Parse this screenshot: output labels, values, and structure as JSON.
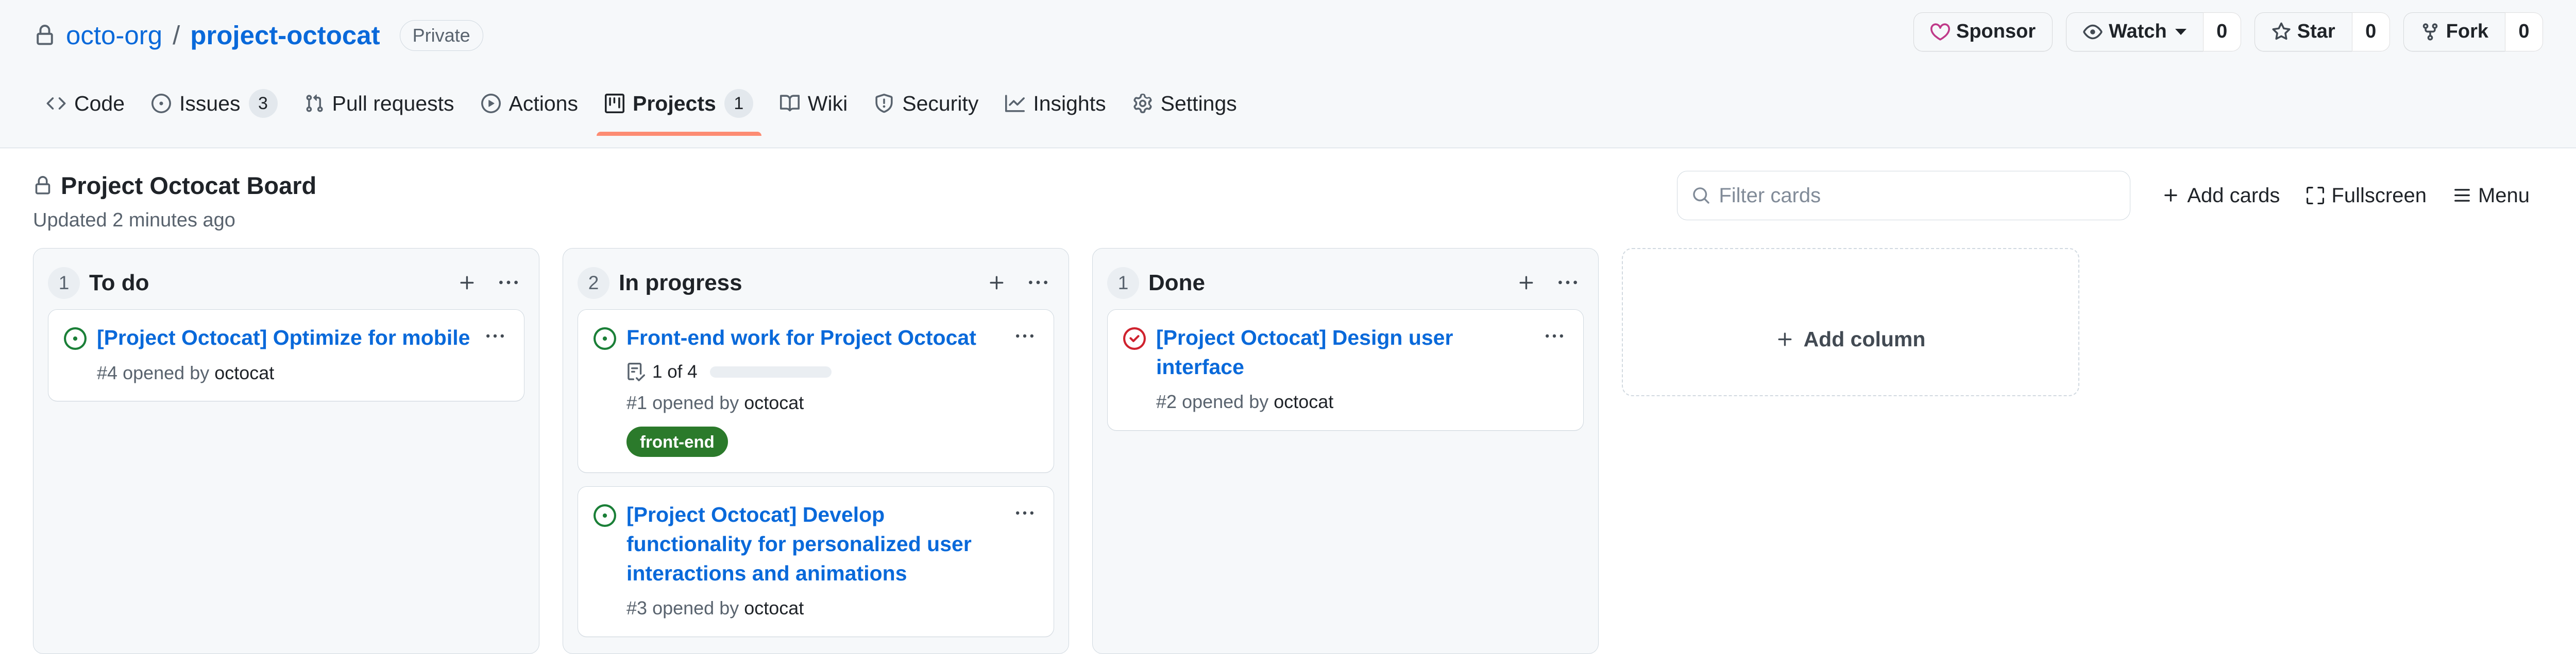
{
  "repo": {
    "visibility_icon": "lock-icon",
    "owner": "octo-org",
    "separator": "/",
    "name": "project-octocat",
    "visibility_badge": "Private"
  },
  "repo_actions": {
    "sponsor": {
      "label": "Sponsor",
      "icon": "heart-icon",
      "color": "#bf3989"
    },
    "watch": {
      "label": "Watch",
      "icon": "eye-icon",
      "count": "0"
    },
    "star": {
      "label": "Star",
      "icon": "star-icon",
      "count": "0"
    },
    "fork": {
      "label": "Fork",
      "icon": "fork-icon",
      "count": "0"
    }
  },
  "nav": {
    "active_color": "#fd8c73",
    "items": [
      {
        "label": "Code",
        "icon": "code-icon",
        "counter": null,
        "active": false
      },
      {
        "label": "Issues",
        "icon": "issue-opened-icon",
        "counter": "3",
        "active": false
      },
      {
        "label": "Pull requests",
        "icon": "git-pull-request-icon",
        "counter": null,
        "active": false
      },
      {
        "label": "Actions",
        "icon": "play-icon",
        "counter": null,
        "active": false
      },
      {
        "label": "Projects",
        "icon": "project-icon",
        "counter": "1",
        "active": true
      },
      {
        "label": "Wiki",
        "icon": "book-icon",
        "counter": null,
        "active": false
      },
      {
        "label": "Security",
        "icon": "shield-icon",
        "counter": null,
        "active": false
      },
      {
        "label": "Insights",
        "icon": "graph-icon",
        "counter": null,
        "active": false
      },
      {
        "label": "Settings",
        "icon": "gear-icon",
        "counter": null,
        "active": false
      }
    ]
  },
  "project": {
    "visibility_icon": "lock-icon",
    "title": "Project Octocat Board",
    "updated": "Updated 2 minutes ago"
  },
  "toolbar": {
    "filter": {
      "placeholder": "Filter cards",
      "value": "",
      "icon": "search-icon"
    },
    "add_cards": {
      "label": "Add cards",
      "icon": "plus-icon"
    },
    "fullscreen": {
      "label": "Fullscreen",
      "icon": "screen-full-icon"
    },
    "menu": {
      "label": "Menu",
      "icon": "hamburger-icon"
    }
  },
  "board": {
    "add_column": {
      "label": "Add column",
      "icon": "plus-icon"
    },
    "columns": [
      {
        "count": "1",
        "name": "To do",
        "add_icon": "plus-icon",
        "menu_icon": "kebab-horizontal-icon",
        "cards": [
          {
            "state": "open",
            "state_icon": "issue-opened-icon",
            "title": "[Project Octocat] Optimize for mobile",
            "meta_number": "#4",
            "meta_text": "opened by",
            "meta_author": "octocat",
            "tasks": null,
            "labels": [],
            "menu_icon": "kebab-horizontal-icon"
          }
        ]
      },
      {
        "count": "2",
        "name": "In progress",
        "add_icon": "plus-icon",
        "menu_icon": "kebab-horizontal-icon",
        "cards": [
          {
            "state": "open",
            "state_icon": "issue-opened-icon",
            "title": "Front-end work for Project Octocat",
            "meta_number": "#1",
            "meta_text": "opened by",
            "meta_author": "octocat",
            "tasks": {
              "icon": "tasklist-icon",
              "label": "1 of 4",
              "done": 1,
              "total": 4,
              "percent": 25
            },
            "labels": [
              {
                "name": "front-end",
                "bg": "#2b7a2b",
                "fg": "#ffffff"
              }
            ],
            "menu_icon": "kebab-horizontal-icon"
          },
          {
            "state": "open",
            "state_icon": "issue-opened-icon",
            "title": "[Project Octocat] Develop functionality for personalized user interactions and animations",
            "meta_number": "#3",
            "meta_text": "opened by",
            "meta_author": "octocat",
            "tasks": null,
            "labels": [],
            "menu_icon": "kebab-horizontal-icon"
          }
        ]
      },
      {
        "count": "1",
        "name": "Done",
        "add_icon": "plus-icon",
        "menu_icon": "kebab-horizontal-icon",
        "cards": [
          {
            "state": "closed",
            "state_icon": "issue-closed-icon",
            "title": "[Project Octocat] Design user interface",
            "meta_number": "#2",
            "meta_text": "opened by",
            "meta_author": "octocat",
            "tasks": null,
            "labels": [],
            "menu_icon": "kebab-horizontal-icon"
          }
        ]
      }
    ]
  }
}
